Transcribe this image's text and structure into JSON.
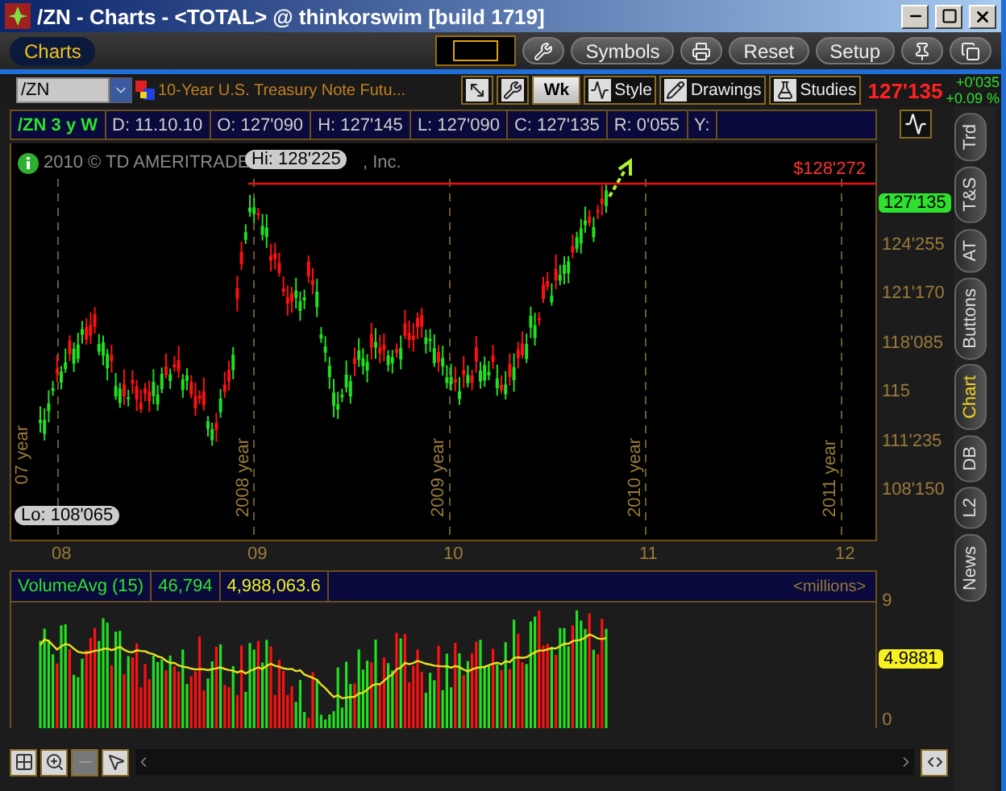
{
  "window": {
    "title": "/ZN - Charts - <TOTAL> @ thinkorswim [build 1719]"
  },
  "toolbar": {
    "tab": {
      "label": "Charts",
      "selected": true
    },
    "items": [
      {
        "kind": "field"
      },
      {
        "kind": "icon"
      },
      {
        "kind": "text",
        "label": "Symbols"
      },
      {
        "kind": "icon"
      },
      {
        "kind": "text",
        "label": "Reset"
      },
      {
        "kind": "text",
        "label": "Setup"
      },
      {
        "kind": "icon"
      },
      {
        "kind": "icon"
      }
    ]
  },
  "symbol_bar": {
    "symbol": "/ZN",
    "description": "10-Year U.S. Treasury Note Futu...",
    "tools": [
      {
        "kind": "icon"
      },
      {
        "kind": "icon"
      },
      {
        "kind": "text",
        "label": "Wk"
      },
      {
        "kind": "icontext",
        "label": "Style"
      },
      {
        "kind": "icontext",
        "label": "Drawings"
      },
      {
        "kind": "icontext",
        "label": "Studies"
      }
    ],
    "last": "127'135",
    "change": "+0'035",
    "change_pct": "+0.09 %"
  },
  "info_bar": {
    "study": "/ZN 3 y W",
    "fields": [
      "D: 11.10.10",
      "O: 127'090",
      "H: 127'145",
      "L: 127'090",
      "C: 127'135",
      "R: 0'055",
      "Y:"
    ]
  },
  "price_chart": {
    "copyright": "2010 © TD AMERITRADE",
    "copyright_tail": ", Inc.",
    "high_label": "Hi: 128'225",
    "low_label": "Lo: 108'065",
    "alert_price": "$128'272",
    "last_price": "127'135",
    "price_ticks": [
      "124'255",
      "121'170",
      "118'085",
      "115",
      "111'235",
      "108'150"
    ],
    "year_markers": [
      "07 year",
      "2008 year",
      "2009 year",
      "2010 year",
      "2011 year"
    ],
    "x_ticks": [
      "08",
      "09",
      "10",
      "11",
      "12"
    ]
  },
  "volume": {
    "study": "VolumeAvg (15)",
    "value": "46,794",
    "average": "4,988,063.6",
    "units": "<millions>",
    "ticks": [
      "9",
      "0"
    ],
    "last": "4.9881"
  },
  "side_tabs": [
    {
      "label": "Trd",
      "selected": false
    },
    {
      "label": "T&S",
      "selected": false
    },
    {
      "label": "AT",
      "selected": false
    },
    {
      "label": "Buttons",
      "selected": false
    },
    {
      "label": "Chart",
      "selected": true
    },
    {
      "label": "DB",
      "selected": false
    },
    {
      "label": "L2",
      "selected": false
    },
    {
      "label": "News",
      "selected": false
    }
  ]
}
